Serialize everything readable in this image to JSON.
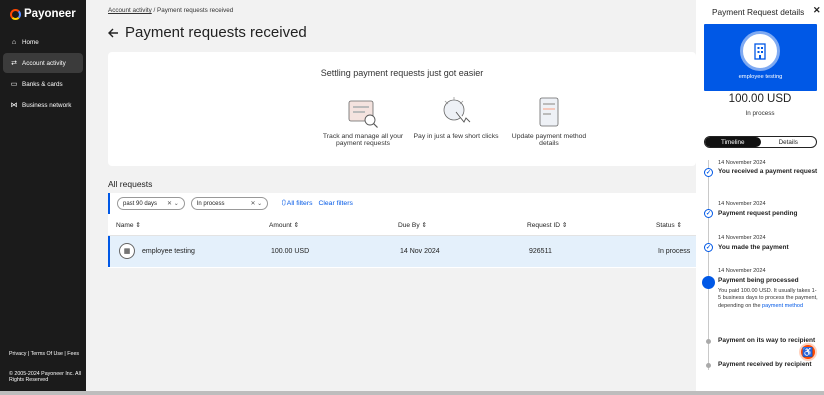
{
  "brand": {
    "name": "Payoneer"
  },
  "sidebar": {
    "items": [
      {
        "label": "Home",
        "icon": "home-icon"
      },
      {
        "label": "Account activity",
        "icon": "swap-icon",
        "active": true
      },
      {
        "label": "Banks & cards",
        "icon": "bank-icon"
      },
      {
        "label": "Business network",
        "icon": "network-icon"
      }
    ],
    "footer": {
      "links": "Privacy | Terms Of Use | Fees",
      "copyright": "© 2005-2024 Payoneer Inc. All Rights Reserved"
    }
  },
  "breadcrumb": {
    "parent": "Account activity",
    "separator": "/",
    "current": "Payment requests received"
  },
  "page": {
    "title": "Payment requests received"
  },
  "promo": {
    "title": "Settling payment requests just got easier",
    "items": [
      {
        "label": "Track and manage all your payment requests"
      },
      {
        "label": "Pay in just a few short clicks"
      },
      {
        "label": "Update payment method details"
      }
    ]
  },
  "requests": {
    "title": "All requests",
    "filters": {
      "date": "past 90 days",
      "status": "In process",
      "all_filters": "All filters",
      "clear_filters": "Clear filters"
    },
    "columns": [
      "Name",
      "Amount",
      "Due By",
      "Request ID",
      "Status"
    ],
    "rows": [
      {
        "name": "employee testing",
        "amount": "100.00 USD",
        "due": "14 Nov 2024",
        "id": "926511",
        "status": "In process"
      }
    ]
  },
  "panel": {
    "title": "Payment Request details",
    "payer": "employee testing",
    "amount": "100.00 USD",
    "status": "In process",
    "tabs": [
      "Timeline",
      "Details"
    ],
    "timeline": [
      {
        "date": "14 November 2024",
        "title": "You received a payment request",
        "state": "done"
      },
      {
        "date": "14 November 2024",
        "title": "Payment request pending",
        "state": "done"
      },
      {
        "date": "14 November 2024",
        "title": "You made the payment",
        "state": "done"
      },
      {
        "date": "14 November 2024",
        "title": "Payment being processed",
        "state": "current",
        "desc": "You paid 100.00 USD. It usually takes 1-5 business days to process the payment, depending on the",
        "link": "payment method"
      },
      {
        "title": "Payment on its way to recipient",
        "state": "pending"
      },
      {
        "title": "Payment received by recipient",
        "state": "pending"
      }
    ]
  },
  "colors": {
    "accent": "#0058e6",
    "sidebar": "#1b1b1b",
    "brand_orange": "#ff4800"
  }
}
